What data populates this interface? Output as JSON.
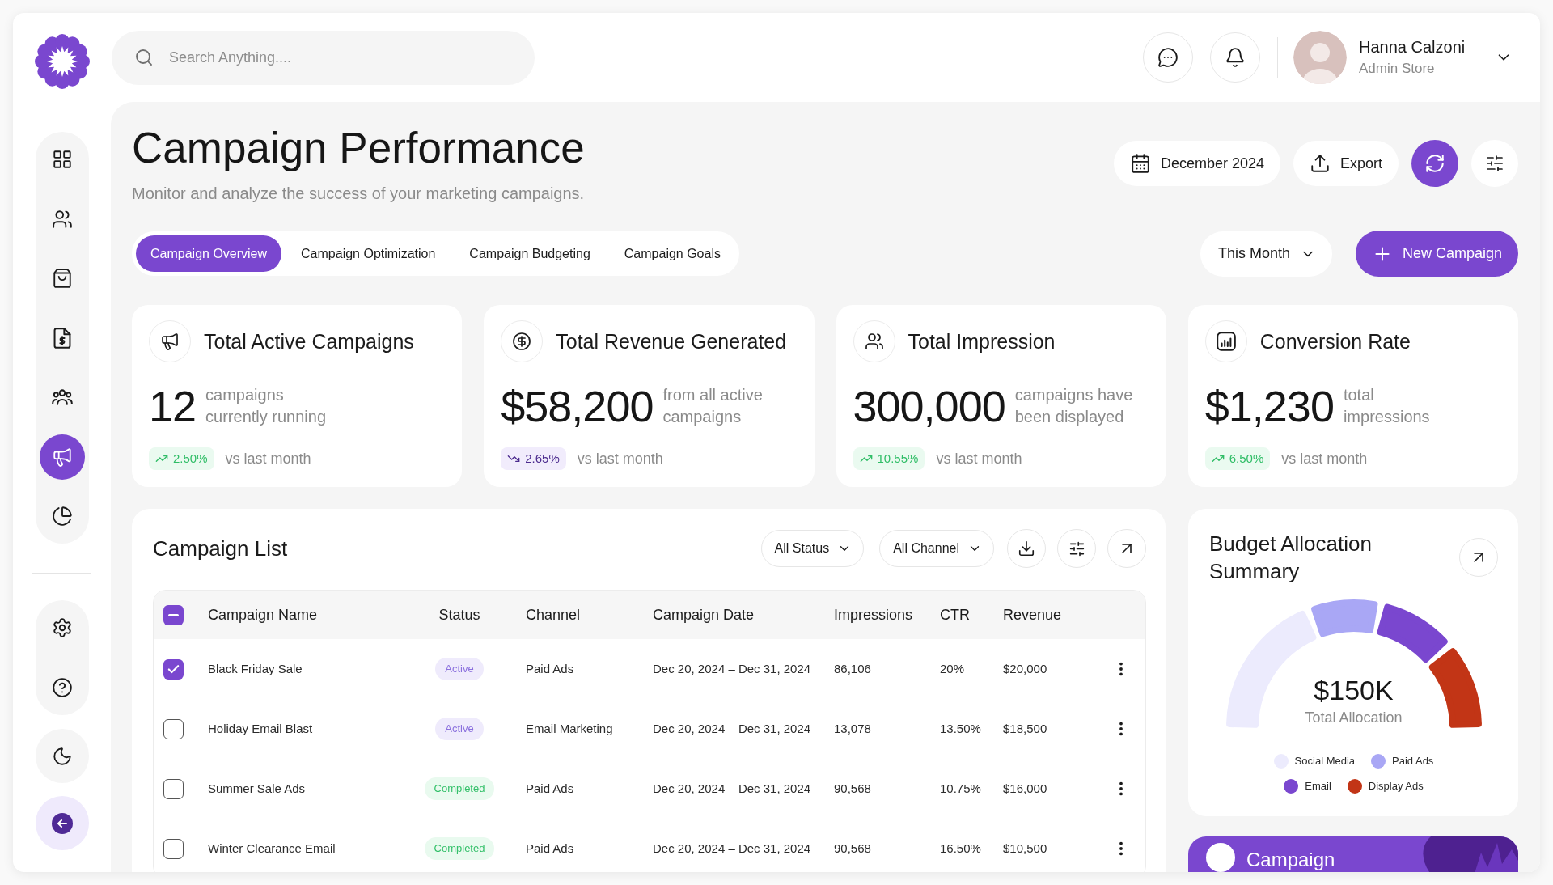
{
  "header": {
    "search": {
      "placeholder": "Search Anything...."
    },
    "user": {
      "name": "Hanna Calzoni",
      "role": "Admin Store"
    }
  },
  "sidebar": {
    "main_items": [
      {
        "selected": false
      },
      {
        "selected": false
      },
      {
        "selected": false
      },
      {
        "selected": false
      },
      {
        "selected": false
      },
      {
        "selected": true
      },
      {
        "selected": false
      }
    ],
    "system_items": [
      {
        "selected": false
      },
      {
        "selected": false
      }
    ]
  },
  "page": {
    "title": "Campaign Performance",
    "subtitle": "Monitor and analyze the success of your marketing campaigns.",
    "date_button": "December 2024",
    "export_button": "Export"
  },
  "tabs": [
    {
      "label": "Campaign Overview",
      "selected": true
    },
    {
      "label": "Campaign Optimization",
      "selected": false
    },
    {
      "label": "Campaign Budgeting",
      "selected": false
    },
    {
      "label": "Campaign Goals",
      "selected": false
    }
  ],
  "period_filter": "This Month",
  "new_campaign_button": "New Campaign",
  "stats": [
    {
      "title": "Total Active Campaigns",
      "value": "12",
      "description_lines": [
        "campaigns",
        "currently running"
      ],
      "change": "2.50%",
      "rising": true,
      "comparison": "vs last month"
    },
    {
      "title": "Total Revenue Generated",
      "value": "$58,200",
      "description_lines": [
        "from all active",
        "campaigns"
      ],
      "change": "2.65%",
      "rising": false,
      "comparison": "vs last month"
    },
    {
      "title": "Total Impression",
      "value": "300,000",
      "description_lines": [
        "campaigns have",
        "been displayed"
      ],
      "change": "10.55%",
      "rising": true,
      "comparison": "vs last month"
    },
    {
      "title": "Conversion Rate",
      "value": "$1,230",
      "description_lines": [
        "total",
        "impressions"
      ],
      "change": "6.50%",
      "rising": true,
      "comparison": "vs last month"
    }
  ],
  "campaign_list": {
    "title": "Campaign List",
    "filters": [
      "All Status",
      "All Channel"
    ],
    "header_checkbox": {
      "checked": true,
      "indeterminate": true
    },
    "columns": [
      "Campaign Name",
      "Status",
      "Channel",
      "Campaign Date",
      "Impressions",
      "CTR",
      "Revenue"
    ],
    "rows": [
      {
        "checked": true,
        "name": "Black Friday Sale",
        "status": {
          "label": "Active",
          "kind": "active"
        },
        "channel": "Paid Ads",
        "date": "Dec 20, 2024 – Dec 31, 2024",
        "impressions": "86,106",
        "ctr": "20%",
        "revenue": "$20,000"
      },
      {
        "checked": false,
        "name": "Holiday Email Blast",
        "status": {
          "label": "Active",
          "kind": "active"
        },
        "channel": "Email Marketing",
        "date": "Dec 20, 2024 – Dec 31, 2024",
        "impressions": "13,078",
        "ctr": "13.50%",
        "revenue": "$18,500"
      },
      {
        "checked": false,
        "name": "Summer Sale Ads",
        "status": {
          "label": "Completed",
          "kind": "completed"
        },
        "channel": "Paid Ads",
        "date": "Dec 20, 2024 – Dec 31, 2024",
        "impressions": "90,568",
        "ctr": "10.75%",
        "revenue": "$16,000"
      },
      {
        "checked": false,
        "name": "Winter Clearance Email",
        "status": {
          "label": "Completed",
          "kind": "completed"
        },
        "channel": "Paid Ads",
        "date": "Dec 20, 2024 – Dec 31, 2024",
        "impressions": "90,568",
        "ctr": "16.50%",
        "revenue": "$10,500"
      }
    ]
  },
  "budget": {
    "title": "Budget Allocation Summary",
    "total": "$150K",
    "total_label": "Total Allocation",
    "legend": [
      {
        "label": "Social Media",
        "color": "#ecebfd"
      },
      {
        "label": "Paid Ads",
        "color": "#a9a7f5"
      },
      {
        "label": "Email",
        "color": "#7a47cf"
      },
      {
        "label": "Display Ads",
        "color": "#c23516"
      }
    ]
  },
  "promo": {
    "title": "Campaign"
  }
}
